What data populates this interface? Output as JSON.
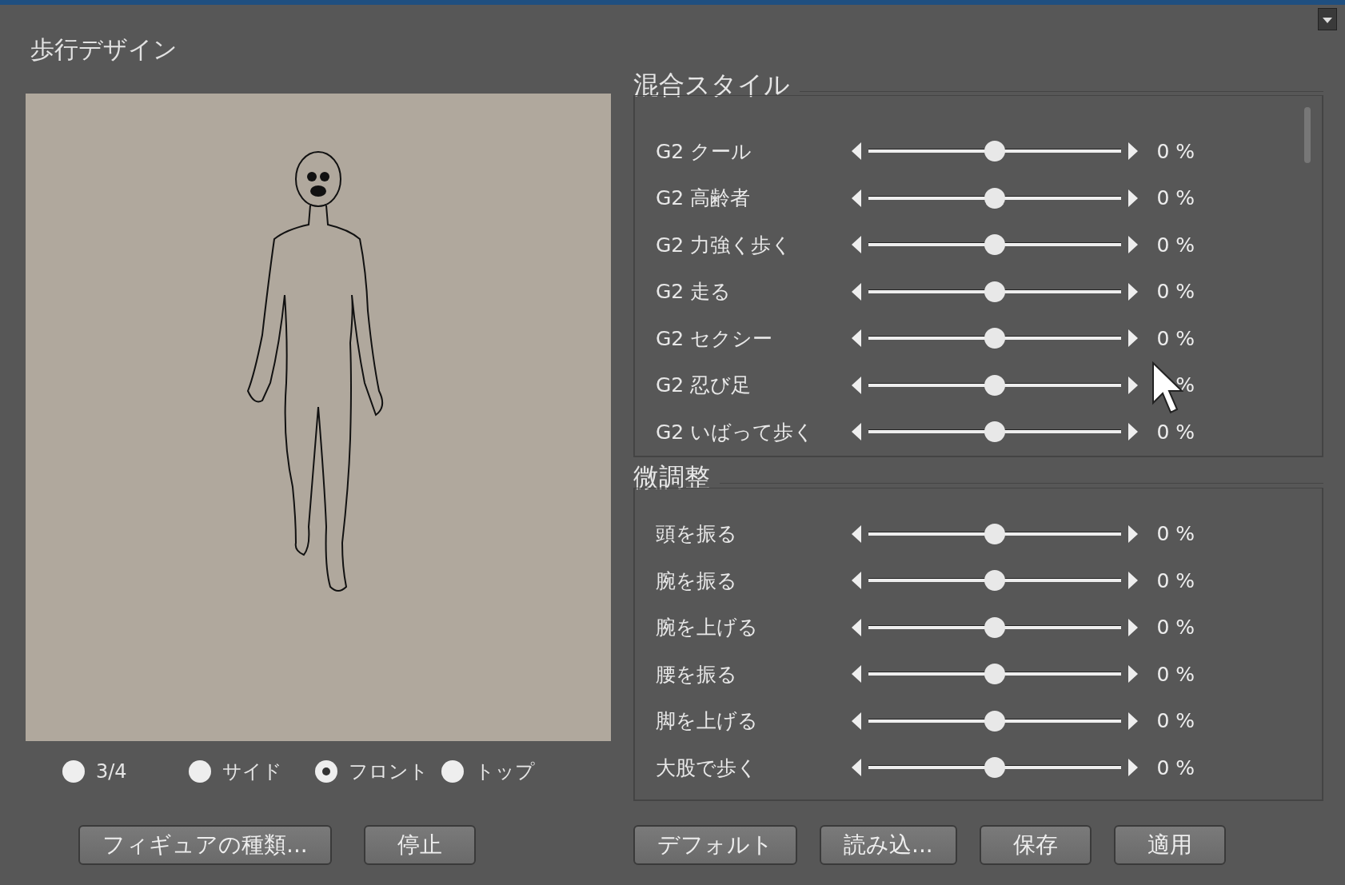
{
  "window": {
    "title": "歩行デザイン"
  },
  "preview": {
    "view_options": [
      {
        "label": "3/4",
        "selected": false
      },
      {
        "label": "サイド",
        "selected": false
      },
      {
        "label": "フロント",
        "selected": true
      },
      {
        "label": "トップ",
        "selected": false
      }
    ]
  },
  "blend_styles": {
    "title": "混合スタイル",
    "sliders": [
      {
        "label": "G2 クール",
        "level": 0.5,
        "reading": "0 %"
      },
      {
        "label": "G2 高齢者",
        "level": 0.5,
        "reading": "0 %"
      },
      {
        "label": "G2 力強く歩く",
        "level": 0.5,
        "reading": "0 %"
      },
      {
        "label": "G2 走る",
        "level": 0.5,
        "reading": "0 %"
      },
      {
        "label": "G2 セクシー",
        "level": 0.5,
        "reading": "0 %"
      },
      {
        "label": "G2 忍び足",
        "level": 0.5,
        "reading": "%"
      },
      {
        "label": "G2 いばって歩く",
        "level": 0.5,
        "reading": "0 %"
      }
    ]
  },
  "fine_tuning": {
    "title": "微調整",
    "sliders": [
      {
        "label": "頭を振る",
        "level": 0.5,
        "reading": "0 %"
      },
      {
        "label": "腕を振る",
        "level": 0.5,
        "reading": "0 %"
      },
      {
        "label": "腕を上げる",
        "level": 0.5,
        "reading": "0 %"
      },
      {
        "label": "腰を振る",
        "level": 0.5,
        "reading": "0 %"
      },
      {
        "label": "脚を上げる",
        "level": 0.5,
        "reading": "0 %"
      },
      {
        "label": "大股で歩く",
        "level": 0.5,
        "reading": "0 %"
      }
    ]
  },
  "buttons_left": [
    "フィギュアの種類...",
    "停止"
  ],
  "buttons_right": [
    "デフォルト",
    "読み込...",
    "保存",
    "適用"
  ]
}
